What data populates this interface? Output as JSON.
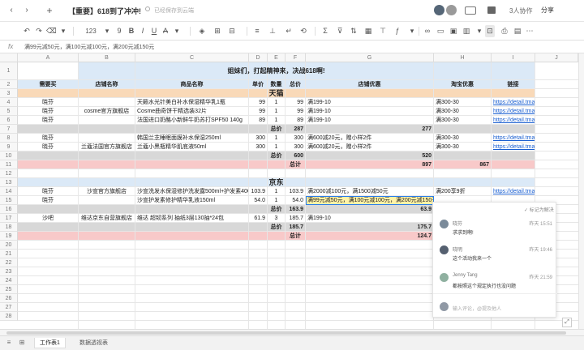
{
  "titlebar": {
    "title": "【重要】618到了冲冲!",
    "status": "已经保存到云端",
    "collaborators": "3人协作",
    "share": "分享",
    "back_icon": "‹",
    "forward_icon": "›",
    "new_icon": "+"
  },
  "formula": {
    "fx": "fx",
    "text": "满99元减50元，满100元减100元，满200元减150元"
  },
  "columns": [
    "A",
    "B",
    "C",
    "D",
    "E",
    "F",
    "G",
    "H",
    "I",
    "J"
  ],
  "rows": [
    "1",
    "2",
    "3",
    "4",
    "5",
    "6",
    "7",
    "8",
    "9",
    "10",
    "11",
    "12",
    "13",
    "14",
    "15",
    "16",
    "17",
    "18",
    "19",
    "20",
    "21",
    "22",
    "23",
    "24",
    "25",
    "26",
    "27",
    "28"
  ],
  "header": {
    "banner": "姐妹们，打起精神来，决战618啊!",
    "buyer": "需要买",
    "shop": "店铺名称",
    "product": "商品名称",
    "price": "单价",
    "qty": "数量",
    "total": "总价",
    "shop_discount": "店铺优惠",
    "platform_discount": "淘宝优惠",
    "link": "链接"
  },
  "tmall": {
    "title": "天猫",
    "rows": [
      {
        "buyer": "晓芬",
        "shop": "",
        "product": "天籁水光针美白补水保湿精华乳1瓶",
        "price": "99",
        "qty": "1",
        "total": "99",
        "disc": "满199-10",
        "plat": "满300-30",
        "link": "https://detail.tmall"
      },
      {
        "buyer": "晓芬",
        "shop": "cosme官方旗舰店",
        "product": "Cosme曲奇饼干精选装32片",
        "price": "99",
        "qty": "1",
        "total": "99",
        "disc": "满199-10",
        "plat": "满300-30",
        "link": "https://detail.tmall"
      },
      {
        "buyer": "晓芬",
        "shop": "",
        "product": "法国进口奶酪小新鲜牛奶苏打SPF50 140g",
        "price": "89",
        "qty": "1",
        "total": "89",
        "disc": "满199-10",
        "plat": "满300-30",
        "link": "https://detail.tmall"
      }
    ],
    "sub1_label": "总价",
    "sub1_total": "287",
    "sub1_g": "277",
    "rows2": [
      {
        "buyer": "晓芬",
        "shop": "",
        "product": "韩国兰芝睡眠面膜补水保湿250ml",
        "price": "300",
        "qty": "1",
        "total": "300",
        "disc": "满600减20元，赠小样2件",
        "plat": "满300-30",
        "link": "https://detail.tmall"
      },
      {
        "buyer": "晓芬",
        "shop": "兰蔻法国官方旗舰店",
        "product": "兰蔻小黑瓶精华肌底液50ml",
        "price": "300",
        "qty": "1",
        "total": "300",
        "disc": "满600减20元，赠小样2件",
        "plat": "满300-30",
        "link": "https://detail.tmall"
      }
    ],
    "sub2_label": "总价",
    "sub2_total": "600",
    "sub2_g": "520",
    "grand_label": "总计",
    "grand_g": "897",
    "grand_h": "867"
  },
  "jd": {
    "title": "京东",
    "rows": [
      {
        "buyer": "晓芬",
        "shop": "沙宣官方旗舰店",
        "product": "沙宣洗发水保湿修护洗发露500ml+护发素400ml",
        "price": "103.9",
        "qty": "1",
        "total": "103.9",
        "disc": "满2000减100元，满1500减50元",
        "plat": "满200享9折",
        "link": "https://detail.tmall"
      },
      {
        "buyer": "晓芬",
        "shop": "",
        "product": "沙宣护发素修护精华乳液150ml",
        "price": "54.0",
        "qty": "1",
        "total": "54.0",
        "disc": "满99元减50元，满100元减100元，满200元减150元",
        "plat": "",
        "link": ""
      }
    ],
    "sub1_label": "总价",
    "sub1_total": "163.9",
    "sub1_g": "63.9",
    "row3": {
      "buyer": "沙吧",
      "shop": "维达京东自营旗舰店",
      "product": "维达 超韧系列 抽纸3层130抽*24包",
      "price": "61.9",
      "qty": "3",
      "total": "185.7",
      "disc": "满199-10",
      "plat": "",
      "link": ""
    },
    "sub2_label": "总价",
    "sub2_total": "185.7",
    "sub2_g": "175.7",
    "grand_label": "总计",
    "grand_g": "124.7"
  },
  "comments": {
    "resolve": "✓ 标记为解决",
    "items": [
      {
        "name": "晓芬",
        "time": "昨天 15:51",
        "text": "求求到啊!"
      },
      {
        "name": "晓明",
        "time": "昨天 19:46",
        "text": "这个活动我来一个"
      },
      {
        "name": "Jenny Tang",
        "time": "昨天 21:59",
        "text": "都按照这个规定执行也没问题"
      }
    ],
    "reply_placeholder": "输入评论，@提及他人"
  },
  "sheets": {
    "tab1": "工作表1",
    "tab2": "数据透视表"
  }
}
